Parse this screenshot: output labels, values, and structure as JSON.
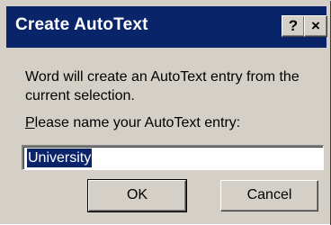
{
  "dialog": {
    "title": "Create AutoText",
    "help_label": "?",
    "close_label": "×",
    "message": "Word will create an AutoText entry from the current selection.",
    "prompt_accel": "P",
    "prompt_rest": "lease name your AutoText entry:",
    "input_value": "University",
    "ok_label": "OK",
    "cancel_label": "Cancel"
  },
  "colors": {
    "titlebar": "#0a246a",
    "face": "#d4d0c8",
    "selection": "#0a246a"
  }
}
